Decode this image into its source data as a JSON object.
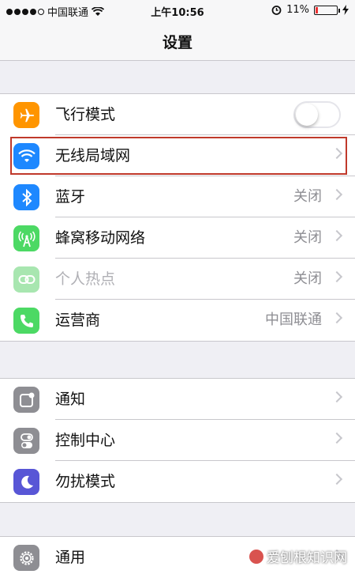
{
  "status_bar": {
    "carrier": "中国联通",
    "time": "上午10:56",
    "battery_percent": "11%",
    "battery_level": 0.11
  },
  "nav": {
    "title": "设置"
  },
  "group1": [
    {
      "label": "飞行模式",
      "icon": "airplane-icon",
      "color": "#ff9500",
      "toggle": false
    },
    {
      "label": "无线局域网",
      "icon": "wifi-icon",
      "color": "#1e88ff"
    },
    {
      "label": "蓝牙",
      "value": "关闭",
      "icon": "bluetooth-icon",
      "color": "#1e88ff"
    },
    {
      "label": "蜂窝移动网络",
      "value": "关闭",
      "icon": "cellular-icon",
      "color": "#4cd964"
    },
    {
      "label": "个人热点",
      "value": "关闭",
      "icon": "hotspot-icon",
      "color": "#a8e6b0"
    },
    {
      "label": "运营商",
      "value": "中国联通",
      "icon": "phone-icon",
      "color": "#4cd964"
    }
  ],
  "group2": [
    {
      "label": "通知",
      "icon": "notifications-icon",
      "color": "#8e8e93"
    },
    {
      "label": "控制中心",
      "icon": "control-center-icon",
      "color": "#8e8e93"
    },
    {
      "label": "勿扰模式",
      "icon": "moon-icon",
      "color": "#5856d6"
    }
  ],
  "group3": [
    {
      "label": "通用",
      "icon": "gear-icon",
      "color": "#8e8e93"
    }
  ],
  "watermark": {
    "text": "爱刨根知识网"
  },
  "highlight_color": "#c0392b"
}
